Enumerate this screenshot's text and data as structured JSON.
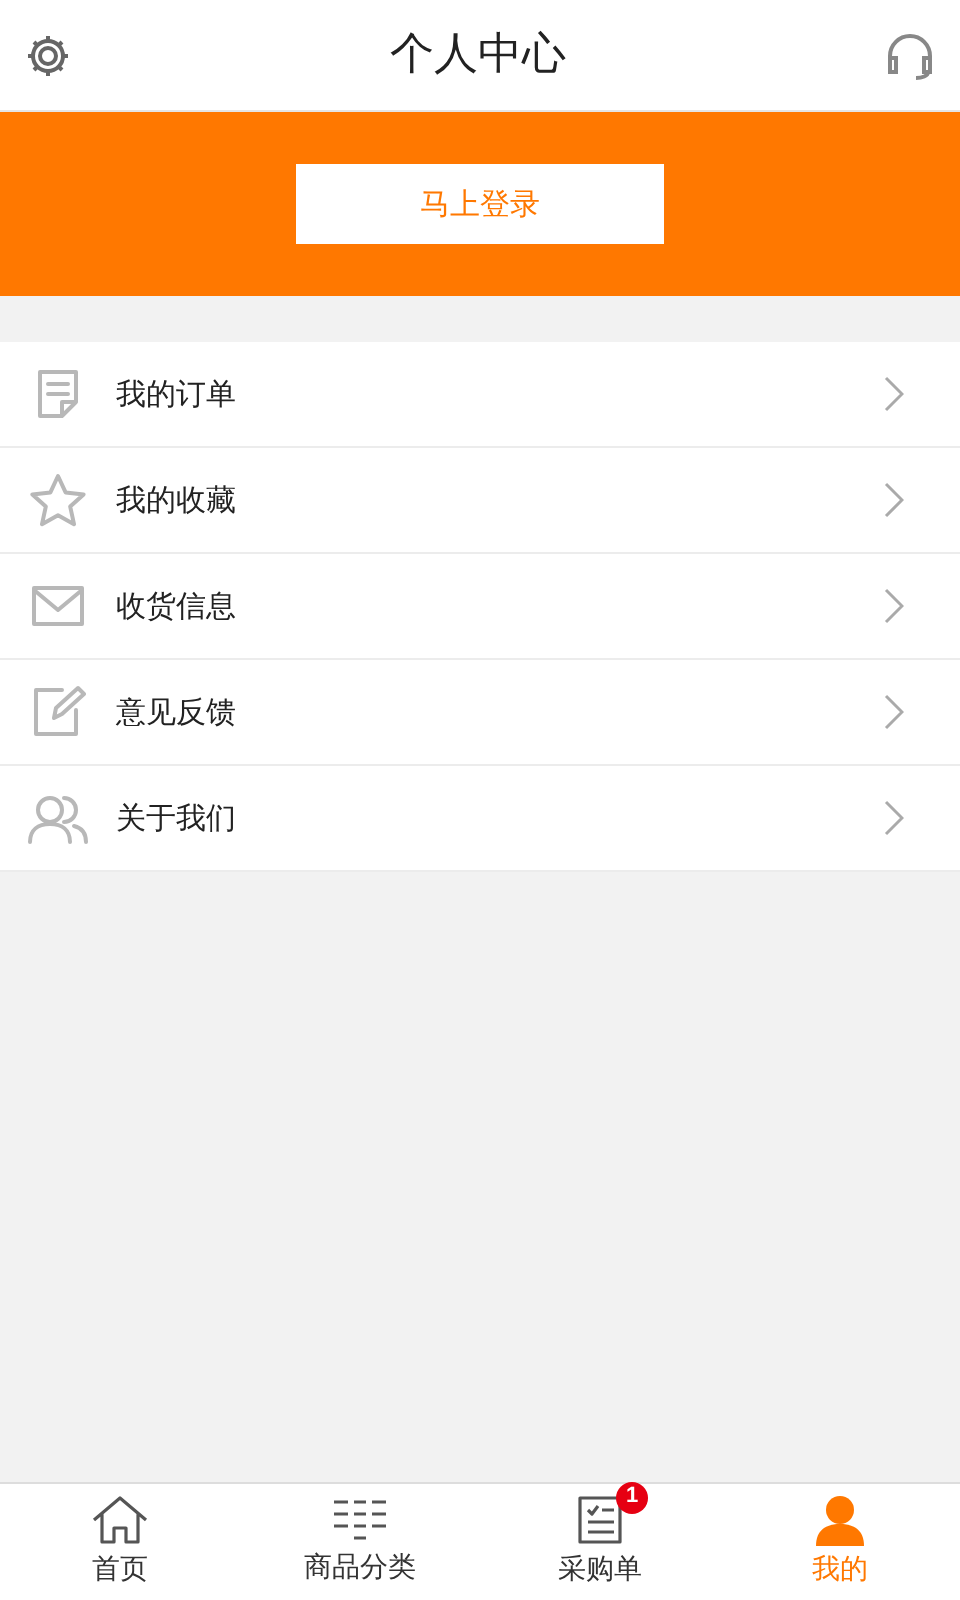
{
  "header": {
    "title": "个人中心"
  },
  "login_button": "马上登录",
  "menu": [
    {
      "kind": "order",
      "label": "我的订单"
    },
    {
      "kind": "star",
      "label": "我的收藏"
    },
    {
      "kind": "mail",
      "label": "收货信息"
    },
    {
      "kind": "edit",
      "label": "意见反馈"
    },
    {
      "kind": "users",
      "label": "关于我们"
    }
  ],
  "tabs": [
    {
      "kind": "home",
      "label": "首页",
      "selected": false
    },
    {
      "kind": "category",
      "label": "商品分类",
      "selected": false
    },
    {
      "kind": "list",
      "label": "采购单",
      "selected": false,
      "badge": "1"
    },
    {
      "kind": "person",
      "label": "我的",
      "selected": true
    }
  ]
}
